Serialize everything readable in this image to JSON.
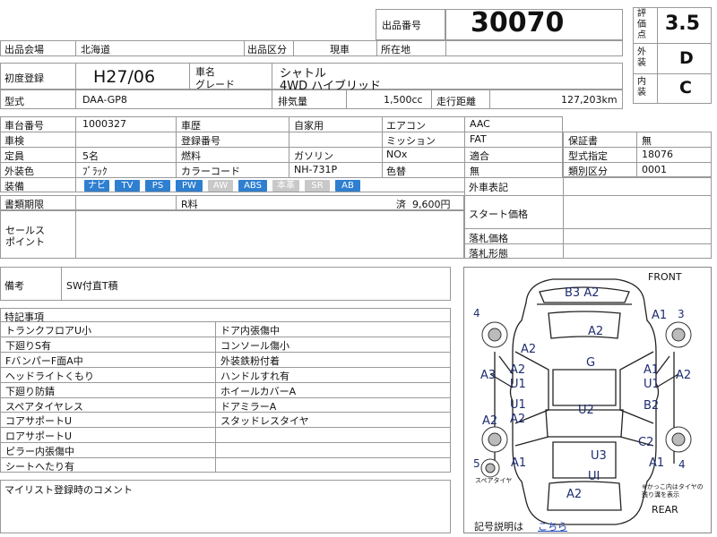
{
  "lot": {
    "label": "出品番号",
    "value": "30070"
  },
  "grade": {
    "score_label": "評価点",
    "score": "3.5",
    "exterior_label": "外装",
    "exterior": "D",
    "interior_label": "内装",
    "interior": "C"
  },
  "header": {
    "venue_label": "出品会場",
    "venue": "北海道",
    "category_label": "出品区分",
    "category": "現車",
    "location_label": "所在地",
    "location": ""
  },
  "vehicle": {
    "first_reg_label": "初度登録",
    "first_reg": "H27/06",
    "name_label": "車名",
    "grade_label": "グレード",
    "name": "シャトル",
    "grade": "4WD ハイブリッド",
    "model_label": "型式",
    "model": "DAA-GP8",
    "displacement_label": "排気量",
    "displacement": "1,500cc",
    "mileage_label": "走行距離",
    "mileage": "127,203km"
  },
  "specs": {
    "chassis_label": "車台番号",
    "chassis": "1000327",
    "history_label": "車歴",
    "history": "自家用",
    "ac_label": "エアコン",
    "ac": "AAC",
    "inspection_label": "車検",
    "inspection": "",
    "regnum_label": "登録番号",
    "regnum": "",
    "mission_label": "ミッション",
    "mission": "FAT",
    "warranty_label": "保証書",
    "warranty": "無",
    "capacity_label": "定員",
    "capacity": "5名",
    "fuel_label": "燃料",
    "fuel": "ガソリン",
    "nox_label": "NOx",
    "nox": "適合",
    "typedesig_label": "型式指定",
    "typedesig": "18076",
    "color_label": "外装色",
    "color": "ﾌﾞﾗｯｸ",
    "colorcode_label": "カラーコード",
    "colorcode": "NH-731P",
    "colorchange_label": "色替",
    "colorchange": "無",
    "classcat_label": "類別区分",
    "classcat": "0001"
  },
  "equipment": {
    "label": "装備",
    "items": [
      {
        "name": "ナビ",
        "on": true
      },
      {
        "name": "TV",
        "on": true
      },
      {
        "name": "PS",
        "on": true
      },
      {
        "name": "PW",
        "on": true
      },
      {
        "name": "AW",
        "on": false
      },
      {
        "name": "ABS",
        "on": true
      },
      {
        "name": "本革",
        "on": false
      },
      {
        "name": "SR",
        "on": false
      },
      {
        "name": "AB",
        "on": true
      }
    ]
  },
  "documents": {
    "label": "書類期限",
    "r_label": "R料",
    "r_value": "済  9,600円"
  },
  "sales": {
    "label_line1": "セールス",
    "label_line2": "ポイント"
  },
  "side": {
    "exterior_label": "外車表記",
    "start_label": "スタート価格",
    "sold_label": "落札価格",
    "sold_form_label": "落札形態"
  },
  "remarks": {
    "label": "備考",
    "value": "SW付直T積"
  },
  "special": {
    "title": "特記事項",
    "left": [
      "トランクフロアU小",
      "下廻りS有",
      "FバンパーF面A中",
      "ヘッドライトくもり",
      "下廻り防錆",
      "スペアタイヤレス",
      "コアサポートU",
      "ロアサポートU",
      "ピラー内張傷中",
      "シートへたり有"
    ],
    "right": [
      "ドア内張傷中",
      "コンソール傷小",
      "外装鉄粉付着",
      "ハンドルすれ有",
      "ホイールカバーA",
      "ドアミラーA",
      "スタッドレスタイヤ",
      "",
      "",
      ""
    ]
  },
  "mylist": {
    "label": "マイリスト登録時のコメント"
  },
  "diagram": {
    "front": "FRONT",
    "rear": "REAR",
    "spare": "スペアタイヤ",
    "caption": "※かっこ内はタイヤの残り溝を表示",
    "legend_label": "記号説明は",
    "legend_link": "こちら",
    "wheel_nums": {
      "fl": "4",
      "fr": "3",
      "rl": "5",
      "rr": "4"
    },
    "marks": [
      "B3 A2",
      "A1",
      "A2",
      "A2",
      "A2",
      "A3",
      "G",
      "A1",
      "U1",
      "A2",
      "A2",
      "U1",
      "U1",
      "A2",
      "U2",
      "B2",
      "U3",
      "C2",
      "A1",
      "UI",
      "A1",
      "A2"
    ]
  }
}
